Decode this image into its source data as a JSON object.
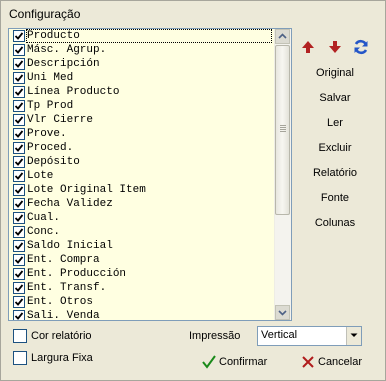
{
  "window": {
    "title": "Configuração"
  },
  "list_items": [
    {
      "label": "Producto",
      "checked": true,
      "selected": true
    },
    {
      "label": "Másc. Agrup.",
      "checked": true
    },
    {
      "label": "Descripción",
      "checked": true
    },
    {
      "label": "Uni Med",
      "checked": true
    },
    {
      "label": "Línea Producto",
      "checked": true
    },
    {
      "label": "Tp Prod",
      "checked": true
    },
    {
      "label": "Vlr Cierre",
      "checked": true
    },
    {
      "label": "Prove.",
      "checked": true
    },
    {
      "label": "Proced.",
      "checked": true
    },
    {
      "label": "Depósito",
      "checked": true
    },
    {
      "label": "Lote",
      "checked": true
    },
    {
      "label": "Lote Original Item",
      "checked": true
    },
    {
      "label": "Fecha Validez",
      "checked": true
    },
    {
      "label": "Cual.",
      "checked": true
    },
    {
      "label": "Conc.",
      "checked": true
    },
    {
      "label": "Saldo Inicial",
      "checked": true
    },
    {
      "label": "Ent. Compra",
      "checked": true
    },
    {
      "label": "Ent. Producción",
      "checked": true
    },
    {
      "label": "Ent. Transf.",
      "checked": true
    },
    {
      "label": "Ent. Otros",
      "checked": true
    },
    {
      "label": "Sali. Venda",
      "checked": true
    }
  ],
  "side_buttons": {
    "original": "Original",
    "salvar": "Salvar",
    "ler": "Ler",
    "excluir": "Excluir",
    "relatorio": "Relatório",
    "fonte": "Fonte",
    "colunas": "Colunas"
  },
  "options": {
    "cor_relatorio": "Cor relatório",
    "largura_fixa": "Largura Fixa",
    "impressao_label": "Impressão",
    "impressao_value": "Vertical"
  },
  "actions": {
    "confirmar": "Confirmar",
    "cancelar": "Cancelar"
  },
  "colors": {
    "arrow_red": "#b22222",
    "refresh_blue": "#2456c8",
    "confirm_green": "#1a8a1a",
    "cancel_red": "#b01c1c",
    "list_bg": "#ffffe1",
    "dialog_bg": "#ece9d8"
  },
  "icons": {
    "move_up": "arrow-up-icon",
    "move_down": "arrow-down-icon",
    "refresh": "refresh-icon",
    "confirm": "checkmark-icon",
    "cancel": "x-icon"
  }
}
